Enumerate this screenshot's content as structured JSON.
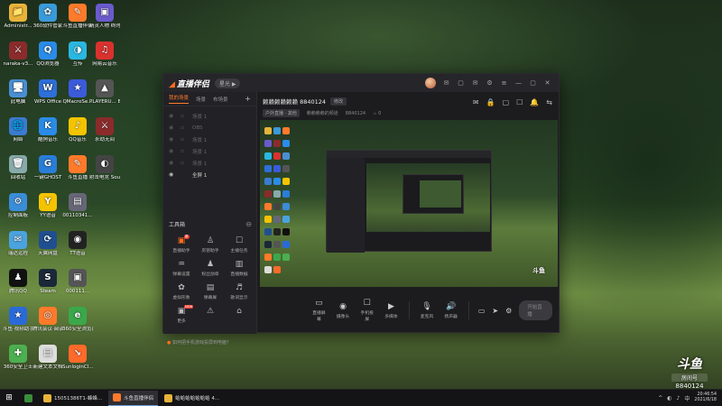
{
  "desktop": {
    "icons": [
      {
        "label": "Administr...",
        "glyph": "📁",
        "color": "#e8b33a"
      },
      {
        "label": "360软件管家",
        "glyph": "✿",
        "color": "#3a9ad9"
      },
      {
        "label": "斗鱼直播伴侣",
        "glyph": "✎",
        "color": "#ff7a2a"
      },
      {
        "label": "精灵人物 终时 ...",
        "glyph": "▣",
        "color": "#6a5acd"
      },
      {
        "label": "naraka-v3...",
        "glyph": "⚔",
        "color": "#8b2b2b"
      },
      {
        "label": "QQ浏览器",
        "glyph": "Q",
        "color": "#2a8ce8"
      },
      {
        "label": "互传",
        "glyph": "◑",
        "color": "#2ab7e0"
      },
      {
        "label": "网易云音乐",
        "glyph": "♫",
        "color": "#d9322e"
      },
      {
        "label": "此电脑",
        "glyph": "🖥",
        "color": "#4a8fd4"
      },
      {
        "label": "WPS Office",
        "glyph": "W",
        "color": "#2e6fd8"
      },
      {
        "label": "QMacroSe...",
        "glyph": "★",
        "color": "#3b5bdb"
      },
      {
        "label": "PLAYERU... BATTLEG...",
        "glyph": "▲",
        "color": "#555"
      },
      {
        "label": "网络",
        "glyph": "🌐",
        "color": "#3a7cd0"
      },
      {
        "label": "酷狗音乐",
        "glyph": "K",
        "color": "#2a8ce8"
      },
      {
        "label": "QQ音乐",
        "glyph": "♪",
        "color": "#f5c400"
      },
      {
        "label": "永劫无间",
        "glyph": "⚔",
        "color": "#8b2b2b"
      },
      {
        "label": "回收站",
        "glyph": "🗑",
        "color": "#8aa"
      },
      {
        "label": "一键GHOST",
        "glyph": "G",
        "color": "#2a7dd8"
      },
      {
        "label": "斗鱼直播",
        "glyph": "✎",
        "color": "#ff7a2a"
      },
      {
        "label": "射击电竞 Sound D...",
        "glyph": "◐",
        "color": "#444"
      },
      {
        "label": "控制面板",
        "glyph": "⚙",
        "color": "#3a8dd8"
      },
      {
        "label": "YY语音",
        "glyph": "Y",
        "color": "#f5c400"
      },
      {
        "label": "00110341...",
        "glyph": "▤",
        "color": "#667"
      },
      {
        "label": "",
        "glyph": "",
        "color": "transparent"
      },
      {
        "label": "瑞达远程",
        "glyph": "✉",
        "color": "#4aa3df"
      },
      {
        "label": "天翼网盘",
        "glyph": "⟳",
        "color": "#1f4f8f"
      },
      {
        "label": "TT语音",
        "glyph": "◉",
        "color": "#222"
      },
      {
        "label": "",
        "glyph": "",
        "color": "transparent"
      },
      {
        "label": "腾讯QQ",
        "glyph": "♟",
        "color": "#111"
      },
      {
        "label": "Steam",
        "glyph": "S",
        "color": "#1b2838"
      },
      {
        "label": "000111...",
        "glyph": "▣",
        "color": "#555"
      },
      {
        "label": "",
        "glyph": "",
        "color": "transparent"
      },
      {
        "label": "斗鱼·视频助手",
        "glyph": "★",
        "color": "#2a6ad8"
      },
      {
        "label": "腾讯会议·阅读",
        "glyph": "◎",
        "color": "#ff7a2a"
      },
      {
        "label": "360安全浏览器",
        "glyph": "e",
        "color": "#3aa84a"
      },
      {
        "label": "",
        "glyph": "",
        "color": "transparent"
      },
      {
        "label": "360安全卫士",
        "glyph": "✚",
        "color": "#4caf50"
      },
      {
        "label": "新建文本文档",
        "glyph": "▤",
        "color": "#ddd"
      },
      {
        "label": "SunloginCl...",
        "glyph": "↘",
        "color": "#ff6a2a"
      },
      {
        "label": "",
        "glyph": "",
        "color": "transparent"
      }
    ]
  },
  "app": {
    "logo_text": "直播伴侣",
    "version_pill": "星光 ▶",
    "titlebar_buttons": [
      "✉",
      "▢",
      "✉",
      "⚙",
      "≡",
      "—",
      "▢",
      "✕"
    ],
    "left_tabs": [
      {
        "label": "我的场景",
        "active": true
      },
      {
        "label": "场景",
        "active": false
      },
      {
        "label": "布场景",
        "active": false
      }
    ],
    "add_tab": "+",
    "scenes": [
      {
        "label": "场景 1",
        "active": false
      },
      {
        "label": "OBS",
        "active": false
      },
      {
        "label": "场景 1",
        "active": false
      },
      {
        "label": "场景 1",
        "active": false
      },
      {
        "label": "场景 1",
        "active": false
      },
      {
        "label": "全屏 1",
        "active": true
      }
    ],
    "tools_title": "工具箱",
    "tools": [
      {
        "label": "直播助手",
        "icon": "▣",
        "hot": true,
        "badge": "新"
      },
      {
        "label": "房管助手",
        "icon": "♙",
        "hot": false,
        "badge": ""
      },
      {
        "label": "主播任务",
        "icon": "☐",
        "hot": false,
        "badge": ""
      },
      {
        "label": "弹幕设置",
        "icon": "♒",
        "hot": false,
        "badge": ""
      },
      {
        "label": "粉丝勋章",
        "icon": "♟",
        "hot": false,
        "badge": ""
      },
      {
        "label": "直播数据",
        "icon": "▥",
        "hot": false,
        "badge": ""
      },
      {
        "label": "虚拟形象",
        "icon": "✿",
        "hot": false,
        "badge": ""
      },
      {
        "label": "弹幕屏",
        "icon": "▤",
        "hot": false,
        "badge": ""
      },
      {
        "label": "歌词显示",
        "icon": "♬",
        "hot": false,
        "badge": ""
      },
      {
        "label": "更多",
        "icon": "▣",
        "hot": false,
        "badge": "NEW"
      },
      {
        "label": "",
        "icon": "⚠",
        "hot": false,
        "badge": ""
      },
      {
        "label": "",
        "icon": "⌂",
        "hot": false,
        "badge": ""
      }
    ],
    "footer_tip": "如何把手机游戏投屏到电脑?",
    "room": {
      "title": "赖赖赖赖赖赖 8840124",
      "edit_label": "修改",
      "meta_tags": [
        "户外直播 · 其他",
        "赖赖赖赖的频道",
        "8840124"
      ],
      "viewers": "0",
      "tool_icons": [
        "✉",
        "🔒",
        "▢",
        "☐",
        "🔔",
        "⇆"
      ]
    },
    "preview_watermark": "斗鱼",
    "controls": [
      {
        "label": "直播屏幕",
        "icon": "▭"
      },
      {
        "label": "摄像头",
        "icon": "◉"
      },
      {
        "label": "手机投屏",
        "icon": "☐"
      },
      {
        "label": "多媒体",
        "icon": "▶"
      },
      {
        "label": "麦克风",
        "icon": "🎙"
      },
      {
        "label": "扬声器",
        "icon": "🔊"
      }
    ],
    "start_button": "开始直播"
  },
  "taskbar": {
    "start_icon": "⊞",
    "items": [
      {
        "label": "",
        "color": "#3a8d3a",
        "active": false
      },
      {
        "label": "15051386T1-蜂蜂...",
        "color": "#e8b33a",
        "active": false
      },
      {
        "label": "斗鱼直播伴侣",
        "color": "#ff7a2a",
        "active": true
      },
      {
        "label": "蛤蛤蛤蛤蛤蛤蛤 4...",
        "color": "#e8b33a",
        "active": false
      }
    ],
    "tray_icons": [
      "^",
      "◐",
      "♪",
      "中"
    ],
    "time": "20:46:54",
    "date": "2021/6/18"
  },
  "watermark": {
    "logo": "斗鱼",
    "sub": "房间号",
    "room_id": "8840124"
  }
}
